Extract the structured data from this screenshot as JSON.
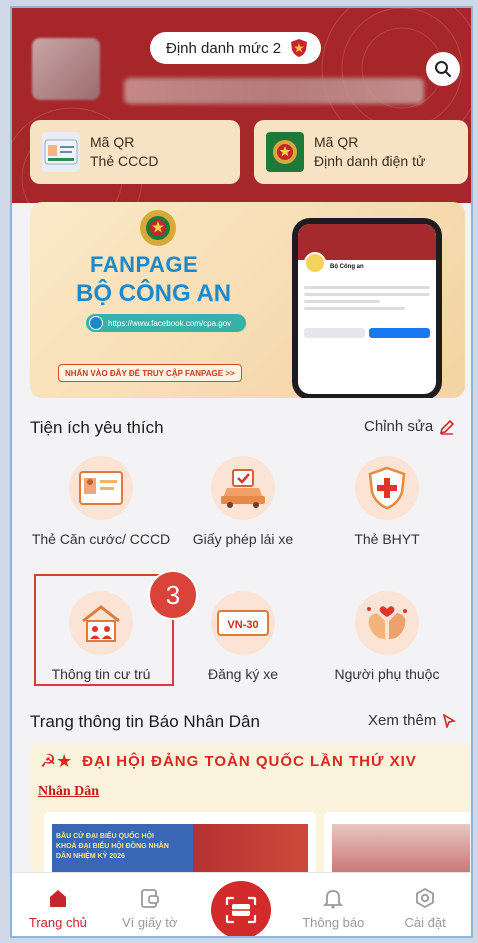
{
  "header": {
    "level_label": "Định danh mức 2",
    "qr_cards": [
      {
        "line1": "Mã QR",
        "line2": "Thẻ CCCD"
      },
      {
        "line1": "Mã QR",
        "line2": "Định danh điện tử"
      }
    ]
  },
  "banner": {
    "title_line1": "FANPAGE",
    "title_line2": "BỘ CÔNG AN",
    "url": "https://www.facebook.com/cpa.gov",
    "cta": "NHẤN VÀO ĐÂY ĐỂ TRUY CẬP FANPAGE >>",
    "mock_page_name": "Bộ Công an"
  },
  "favorites": {
    "title": "Tiện ích yêu thích",
    "edit_label": "Chỉnh sửa",
    "items": [
      {
        "label": "Thẻ Căn cước/ CCCD",
        "icon": "id-card-icon"
      },
      {
        "label": "Giấy phép lái xe",
        "icon": "car-license-icon"
      },
      {
        "label": "Thẻ BHYT",
        "icon": "health-shield-icon"
      },
      {
        "label": "Thông tin cư trú",
        "icon": "house-residence-icon"
      },
      {
        "label": "Đăng ký xe",
        "icon": "plate-icon",
        "plate": "VN-30"
      },
      {
        "label": "Người phụ thuộc",
        "icon": "hands-heart-icon"
      }
    ],
    "step_badge": "3"
  },
  "news": {
    "title": "Trang thông tin Báo Nhân Dân",
    "see_more": "Xem thêm",
    "banner_text": "ĐẠI HỘI ĐẢNG TOÀN QUỐC LẦN THỨ XIV",
    "logo": "Nhân Dân",
    "card1_text": "BẦU CỬ ĐẠI BIỂU QUỐC HỘI KHOÁ ĐẠI BIỂU HỘI ĐỒNG NHÂN DÂN NHIỆM KỲ 2026"
  },
  "nav": {
    "items": [
      "Trang chủ",
      "Ví giấy tờ",
      "Thông báo",
      "Cài đặt"
    ]
  },
  "colors": {
    "brand_red": "#a6262a",
    "accent_red": "#c8242b",
    "highlight": "#d93a3a"
  }
}
